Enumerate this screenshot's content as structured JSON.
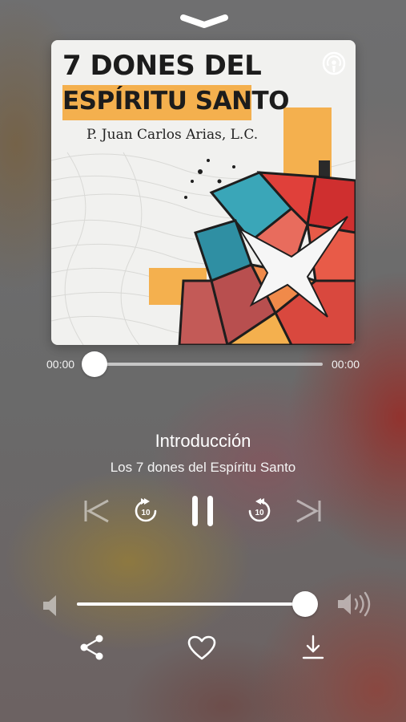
{
  "player": {
    "artwork": {
      "title_line1": "7 DONES DEL",
      "title_line2": "ESPÍRITU SANTO",
      "author": "P. Juan Carlos Arias, L.C.",
      "accent_color": "#f4b04e"
    },
    "progress": {
      "elapsed": "00:00",
      "duration": "00:00",
      "fraction": 0.0
    },
    "track": {
      "title": "Introducción",
      "subtitle": "Los 7 dones del Espíritu Santo"
    },
    "controls": {
      "skip_back_seconds": "10",
      "skip_forward_seconds": "10",
      "state": "playing"
    },
    "volume": {
      "level": 0.95
    },
    "icons": [
      "chevron-down-icon",
      "podcast-icon",
      "previous-track-icon",
      "skip-back-icon",
      "pause-icon",
      "skip-forward-icon",
      "next-track-icon",
      "volume-low-icon",
      "volume-high-icon",
      "share-icon",
      "heart-icon",
      "download-icon"
    ]
  }
}
